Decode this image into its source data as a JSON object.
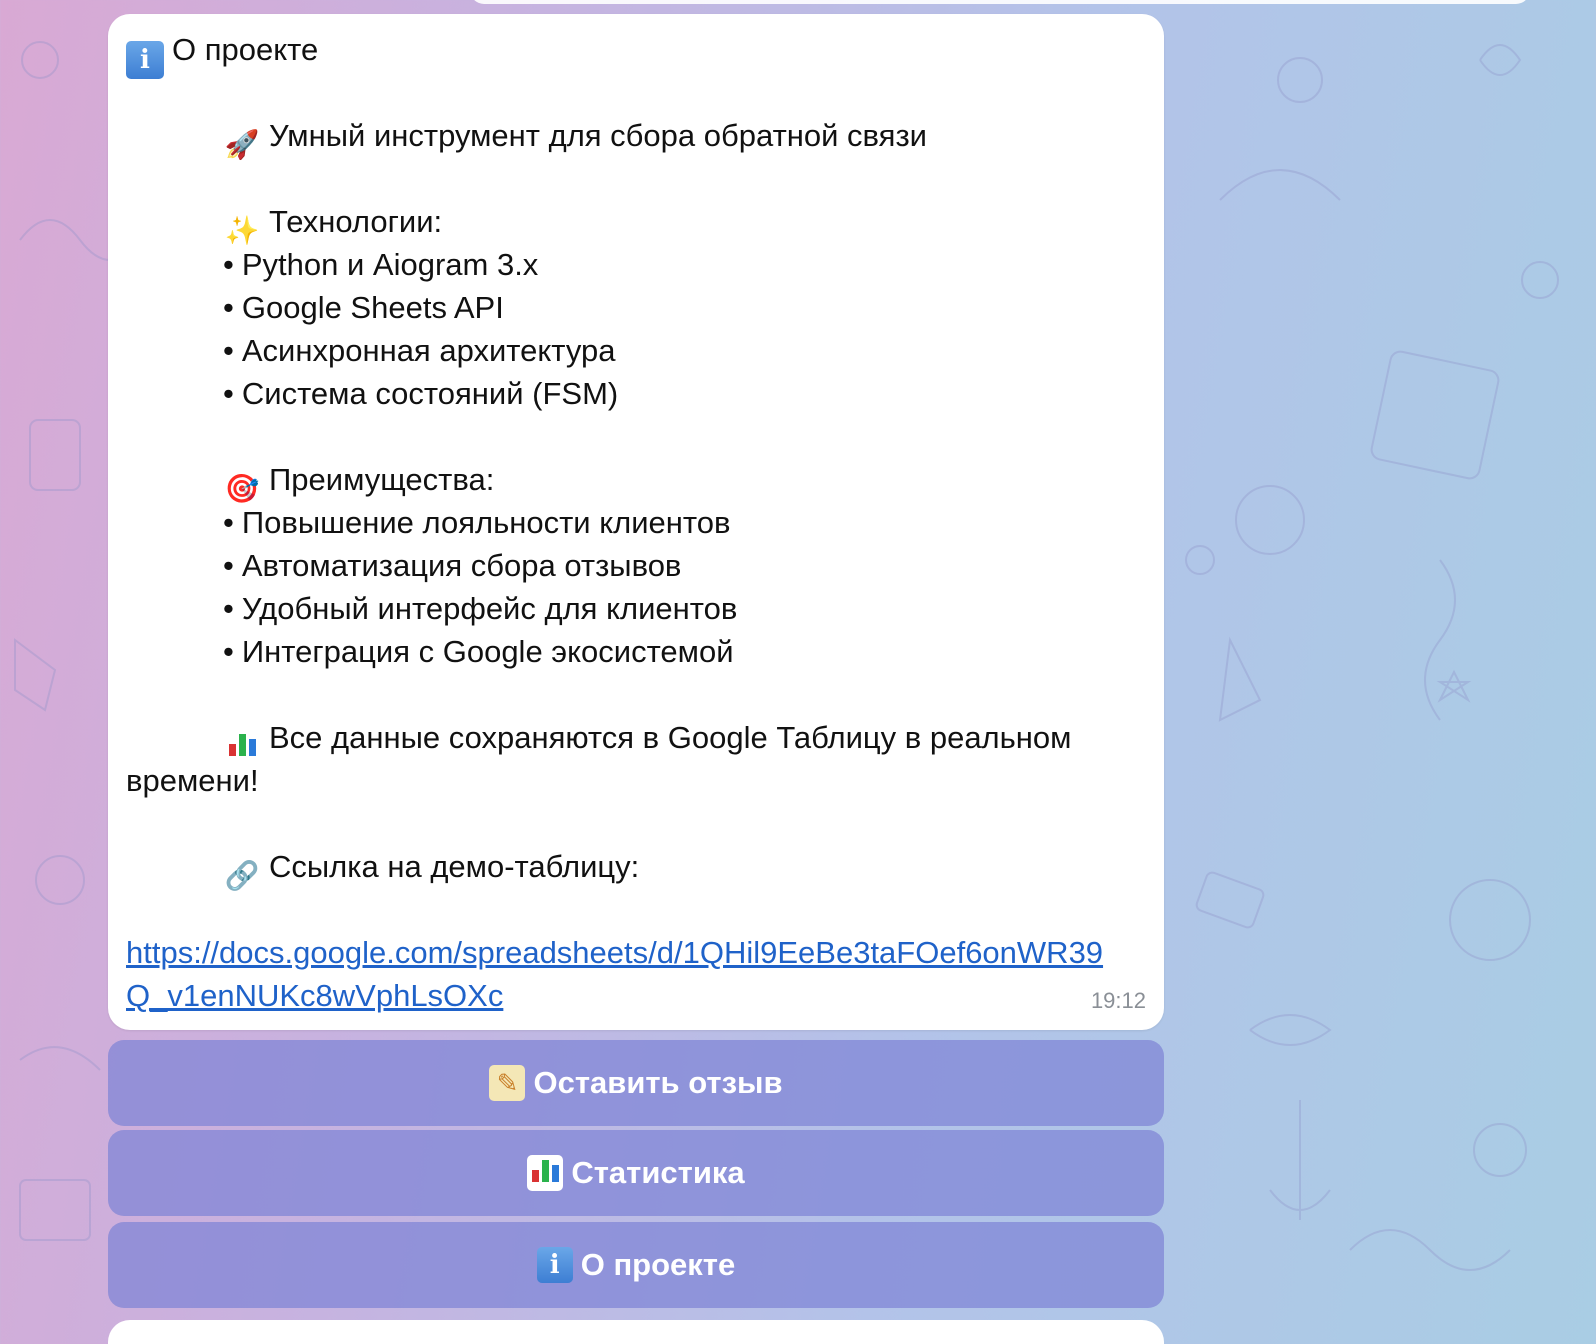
{
  "colors": {
    "background_left": "#d9a9d4",
    "background_right": "#a9cde4",
    "bubble": "#ffffff",
    "link": "#1f62c9",
    "keyboard_button": "#7e84d6",
    "time": "#8a8f96"
  },
  "message": {
    "header": {
      "icon": "info-icon",
      "text": "О проекте"
    },
    "intro": {
      "icon": "rocket-icon",
      "text": "Умный инструмент для сбора обратной связи"
    },
    "technologies": {
      "icon": "sparkles-icon",
      "title": "Технологии:",
      "items": [
        "Python и Aiogram 3.x",
        "Google Sheets API",
        "Асинхронная архитектура",
        "Система состояний (FSM)"
      ]
    },
    "advantages": {
      "icon": "target-icon",
      "title": "Преимущества:",
      "items": [
        "Повышение лояльности клиентов",
        "Автоматизация сбора отзывов",
        "Удобный интерфейс для клиентов",
        "Интеграция с Google экосистемой"
      ]
    },
    "realtime": {
      "icon": "bar-chart-icon",
      "text_line1": "Все данные сохраняются в Google Таблицу в реальном",
      "text_line2": "времени!"
    },
    "demo": {
      "icon": "link-icon",
      "label": "Ссылка на демо-таблицу:"
    },
    "url": "https://docs.google.com/spreadsheets/d/1QHil9EeBe3taFOef6onWR39Q_v1enNUKc8wVphLsOXc",
    "time": "19:12"
  },
  "keyboard": {
    "buttons": [
      {
        "icon": "memo-icon",
        "label": "Оставить отзыв"
      },
      {
        "icon": "bar-chart-icon",
        "label": "Статистика"
      },
      {
        "icon": "info-icon",
        "label": "О проекте"
      }
    ]
  }
}
